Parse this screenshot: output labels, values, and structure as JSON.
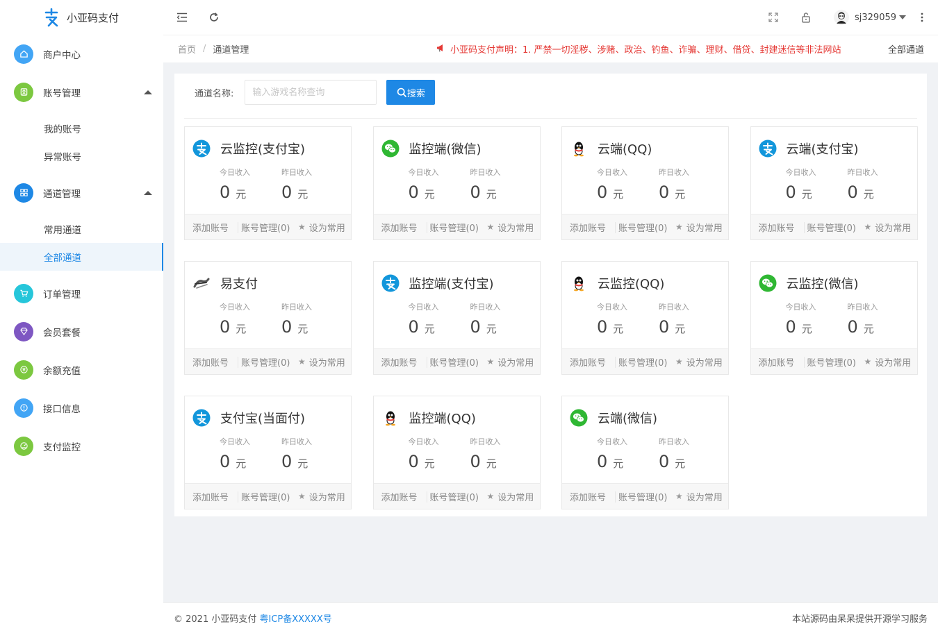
{
  "brand": {
    "name": "小亚码支付",
    "logo_color": "#1e88e5"
  },
  "topbar": {
    "icons": [
      "menu-fold-icon",
      "refresh-icon",
      "fullscreen-icon",
      "lock-icon",
      "more-icon"
    ],
    "username": "sj329059"
  },
  "sidebar": {
    "items": [
      {
        "label": "商户中心",
        "icon": "home-icon",
        "color": "#42a5f5"
      },
      {
        "label": "账号管理",
        "icon": "user-icon",
        "color": "#7cc840",
        "expanded": true,
        "children": [
          {
            "label": "我的账号"
          },
          {
            "label": "异常账号"
          }
        ]
      },
      {
        "label": "通道管理",
        "icon": "apps-icon",
        "color": "#1e88e5",
        "expanded": true,
        "children": [
          {
            "label": "常用通道"
          },
          {
            "label": "全部通道",
            "active": true
          }
        ]
      },
      {
        "label": "订单管理",
        "icon": "cart-icon",
        "color": "#26c6da"
      },
      {
        "label": "会员套餐",
        "icon": "diamond-icon",
        "color": "#7e57c2"
      },
      {
        "label": "余额充值",
        "icon": "recharge-icon",
        "color": "#7cc840"
      },
      {
        "label": "接口信息",
        "icon": "info-icon",
        "color": "#42a5f5"
      },
      {
        "label": "支付监控",
        "icon": "monitor-icon",
        "color": "#7cc840"
      }
    ]
  },
  "breadcrumb": {
    "home": "首页",
    "separator": "/",
    "current": "通道管理"
  },
  "notice": "小亚码支付声明：1. 严禁一切淫秽、涉赌、政治、钓鱼、诈骗、理财、借贷、封建迷信等非法网站",
  "all_channels_label": "全部通道",
  "search": {
    "label": "通道名称:",
    "placeholder": "输入游戏名称查询",
    "button": "搜索"
  },
  "card_labels": {
    "today": "今日收入",
    "yesterday": "昨日收入",
    "unit": "元",
    "add": "添加账号",
    "manage": "账号管理(0)",
    "favorite": "设为常用"
  },
  "channels": [
    {
      "name": "云监控(支付宝)",
      "type": "alipay",
      "today": "0",
      "yesterday": "0"
    },
    {
      "name": "监控端(微信)",
      "type": "wechat",
      "today": "0",
      "yesterday": "0"
    },
    {
      "name": "云端(QQ)",
      "type": "qq",
      "today": "0",
      "yesterday": "0"
    },
    {
      "name": "云端(支付宝)",
      "type": "alipay",
      "today": "0",
      "yesterday": "0"
    },
    {
      "name": "易支付",
      "type": "epay",
      "today": "0",
      "yesterday": "0"
    },
    {
      "name": "监控端(支付宝)",
      "type": "alipay",
      "today": "0",
      "yesterday": "0"
    },
    {
      "name": "云监控(QQ)",
      "type": "qq",
      "today": "0",
      "yesterday": "0"
    },
    {
      "name": "云监控(微信)",
      "type": "wechat",
      "today": "0",
      "yesterday": "0"
    },
    {
      "name": "支付宝(当面付)",
      "type": "alipay",
      "today": "0",
      "yesterday": "0"
    },
    {
      "name": "监控端(QQ)",
      "type": "qq",
      "today": "0",
      "yesterday": "0"
    },
    {
      "name": "云端(微信)",
      "type": "wechat",
      "today": "0",
      "yesterday": "0"
    }
  ],
  "footer": {
    "copyright": "© 2021 小亚码支付",
    "icp": "粤ICP备XXXXX号",
    "powered": "本站源码由呆呆提供开源学习服务"
  },
  "colors": {
    "primary": "#1e88e5",
    "alipay": "#1296db",
    "wechat": "#2fb733",
    "notice": "#e53935"
  }
}
